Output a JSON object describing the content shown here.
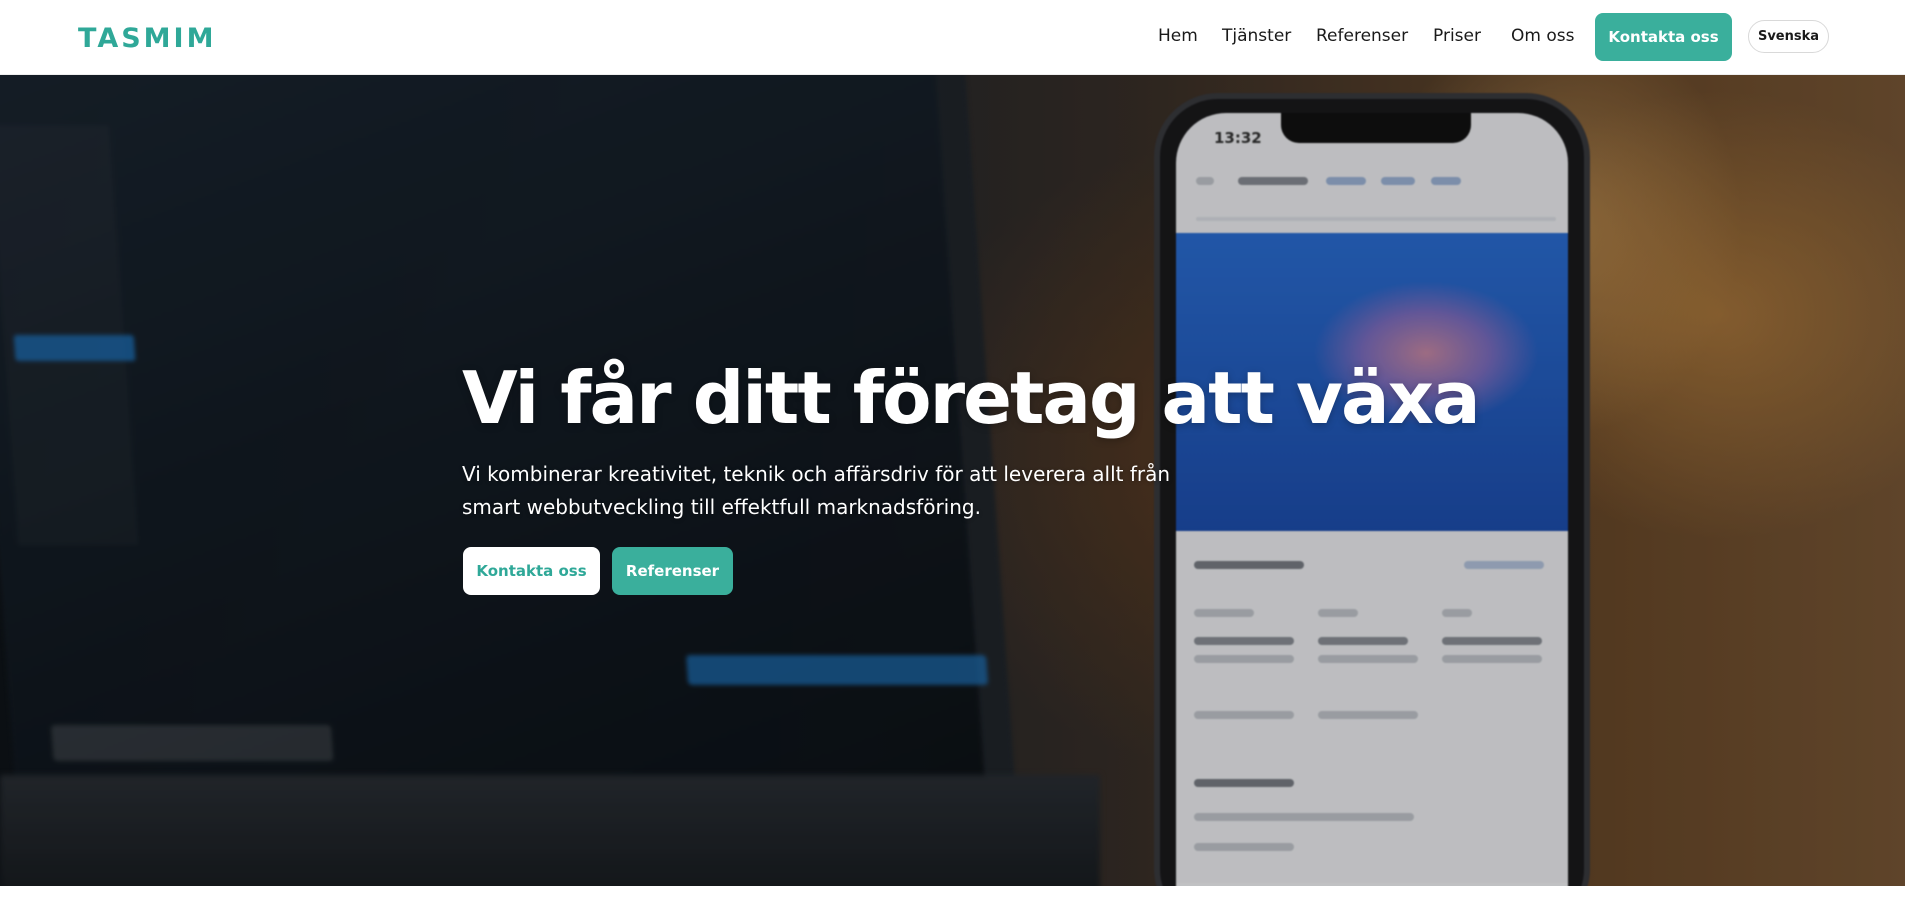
{
  "header": {
    "logo_text": "TASMIM",
    "nav": {
      "hem": "Hem",
      "tjanster": "Tjänster",
      "referenser": "Referenser",
      "priser": "Priser",
      "om_oss": "Om oss"
    },
    "cta_label": "Kontakta oss",
    "language_label": "Svenska"
  },
  "hero": {
    "title": "Vi får ditt företag att växa",
    "subtitle": "Vi kombinerar kreativitet, teknik och affärsdriv för att leverera allt från smart webbutveckling till effektfull marknadsföring.",
    "primary_button": "Kontakta oss",
    "secondary_button": "Referenser",
    "phone_time": "13:32"
  },
  "colors": {
    "brand_teal": "#3aaf9c",
    "logo_teal": "#2fa898",
    "header_bg": "#ffffff",
    "hero_text": "#ffffff"
  }
}
